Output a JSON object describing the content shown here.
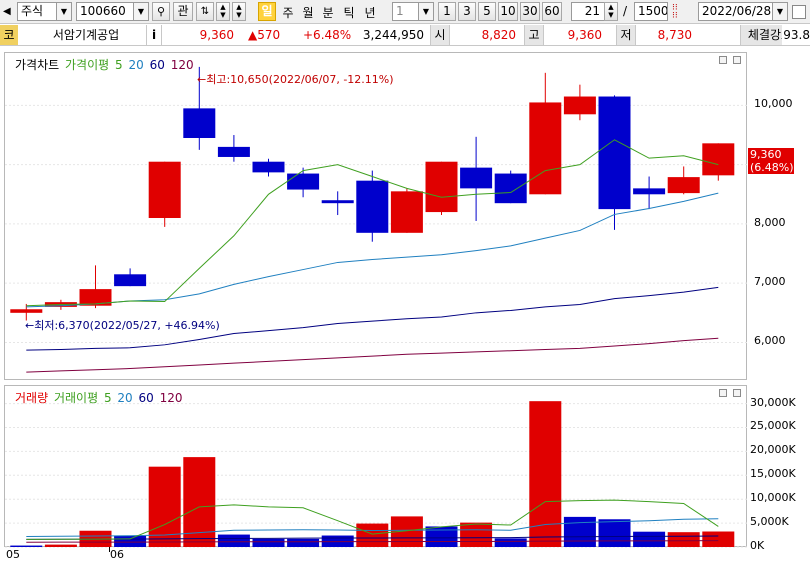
{
  "toolbar": {
    "market_select": "주식",
    "code_input": "100660",
    "gwan_label": "관",
    "il_label": "일",
    "ju_label": "주",
    "wol_label": "월",
    "bun_label": "분",
    "tik_label": "틱",
    "nyeon_label": "년",
    "interval_value": "1",
    "interval_buttons": [
      "1",
      "3",
      "5",
      "10",
      "30",
      "60"
    ],
    "count_value": "21",
    "slash": "/",
    "total_value": "1500",
    "date_value": "2022/06/28"
  },
  "info": {
    "kospi_badge": "코",
    "stock_name": "서암기계공업",
    "info_button": "i",
    "price": "9,360",
    "change": "▲570",
    "change_pct": "+6.48%",
    "volume": "3,244,950",
    "open_label": "시",
    "open_value": "8,820",
    "high_label": "고",
    "high_value": "9,360",
    "low_label": "저",
    "low_value": "8,730",
    "strength_label": "체결강도",
    "strength_value": "93.8"
  },
  "price_panel": {
    "legend_main": "가격차트",
    "legend_ma_label": "가격이평",
    "legend_ma5": "5",
    "legend_ma20": "20",
    "legend_ma60": "60",
    "legend_ma120": "120",
    "max_annotation": "←최고:10,650(2022/06/07, -12.11%)",
    "min_annotation": "←최저:6,370(2022/05/27, +46.94%)",
    "current_price_label": "9,360",
    "current_pct_label": "(6.48%)"
  },
  "volume_panel": {
    "legend_main": "거래량",
    "legend_ma_label": "거래이평",
    "legend_ma5": "5",
    "legend_ma20": "20",
    "legend_ma60": "60",
    "legend_ma120": "120"
  },
  "x_labels": [
    "05",
    "06"
  ],
  "colors": {
    "up": "#e00000",
    "down": "#0000cc",
    "ma5": "#3fa020",
    "ma20": "#2080c0",
    "ma60": "#000080",
    "ma120": "#800040"
  },
  "chart_data": [
    {
      "type": "candlestick",
      "title": "가격차트",
      "ylim": [
        5400,
        10800
      ],
      "y_ticks": [
        "10,000",
        "9,000",
        "8,000",
        "7,000",
        "6,000"
      ],
      "y_tick_values": [
        10000,
        9000,
        8000,
        7000,
        6000
      ],
      "candles": [
        {
          "o": 6500,
          "h": 6650,
          "l": 6370,
          "c": 6560
        },
        {
          "o": 6600,
          "h": 6720,
          "l": 6550,
          "c": 6680
        },
        {
          "o": 6620,
          "h": 7300,
          "l": 6580,
          "c": 6900
        },
        {
          "o": 7150,
          "h": 7250,
          "l": 6950,
          "c": 6950
        },
        {
          "o": 8100,
          "h": 9050,
          "l": 7950,
          "c": 9050
        },
        {
          "o": 9950,
          "h": 10650,
          "l": 9250,
          "c": 9450
        },
        {
          "o": 9300,
          "h": 9500,
          "l": 9050,
          "c": 9130
        },
        {
          "o": 9050,
          "h": 9100,
          "l": 8800,
          "c": 8870
        },
        {
          "o": 8850,
          "h": 8950,
          "l": 8450,
          "c": 8580
        },
        {
          "o": 8400,
          "h": 8550,
          "l": 8150,
          "c": 8350
        },
        {
          "o": 8730,
          "h": 8900,
          "l": 7700,
          "c": 7850
        },
        {
          "o": 7850,
          "h": 8600,
          "l": 7850,
          "c": 8550
        },
        {
          "o": 8200,
          "h": 9050,
          "l": 8150,
          "c": 9050
        },
        {
          "o": 8950,
          "h": 9470,
          "l": 8050,
          "c": 8600
        },
        {
          "o": 8850,
          "h": 8900,
          "l": 8350,
          "c": 8350
        },
        {
          "o": 8500,
          "h": 10550,
          "l": 8500,
          "c": 10050
        },
        {
          "o": 9850,
          "h": 10350,
          "l": 9750,
          "c": 10150
        },
        {
          "o": 10150,
          "h": 10170,
          "l": 7900,
          "c": 8250
        },
        {
          "o": 8600,
          "h": 8800,
          "l": 8250,
          "c": 8500
        },
        {
          "o": 8520,
          "h": 8970,
          "l": 8500,
          "c": 8790
        },
        {
          "o": 8820,
          "h": 9360,
          "l": 8730,
          "c": 9360
        }
      ],
      "ma5": [
        6620,
        6640,
        6650,
        6700,
        6690,
        7250,
        7800,
        8500,
        8900,
        9000,
        8800,
        8600,
        8450,
        8500,
        8530,
        8900,
        9000,
        9420,
        9110,
        9150,
        9000
      ],
      "ma20": [
        6600,
        6620,
        6650,
        6700,
        6720,
        6820,
        6980,
        7110,
        7230,
        7350,
        7400,
        7440,
        7480,
        7550,
        7630,
        7760,
        7890,
        8160,
        8260,
        8380,
        8520
      ],
      "ma60": [
        5870,
        5880,
        5900,
        5910,
        5960,
        6050,
        6150,
        6200,
        6250,
        6320,
        6360,
        6400,
        6430,
        6500,
        6540,
        6600,
        6640,
        6740,
        6790,
        6850,
        6930
      ],
      "ma120": [
        5500,
        5520,
        5540,
        5560,
        5590,
        5620,
        5650,
        5680,
        5710,
        5740,
        5770,
        5800,
        5820,
        5840,
        5860,
        5880,
        5900,
        5940,
        5980,
        6030,
        6070
      ]
    },
    {
      "type": "bar",
      "title": "거래량",
      "ylim": [
        0,
        32000
      ],
      "y_ticks": [
        "30,000K",
        "25,000K",
        "20,000K",
        "15,000K",
        "10,000K",
        "5,000K",
        "0K"
      ],
      "y_tick_values": [
        30000,
        25000,
        20000,
        15000,
        10000,
        5000,
        0
      ],
      "values": [
        300,
        500,
        3400,
        2300,
        16800,
        18800,
        2600,
        1700,
        1700,
        2400,
        4900,
        6400,
        4300,
        5100,
        1800,
        30500,
        6300,
        5800,
        3200,
        3100,
        3240
      ],
      "directions": [
        "down",
        "up",
        "up",
        "down",
        "up",
        "up",
        "down",
        "down",
        "down",
        "down",
        "up",
        "up",
        "down",
        "up",
        "down",
        "up",
        "down",
        "down",
        "down",
        "up",
        "up"
      ],
      "ma5": [
        1600,
        1620,
        1650,
        1700,
        4700,
        8400,
        8800,
        8400,
        8200,
        5500,
        2700,
        3400,
        4200,
        4800,
        4600,
        9500,
        9700,
        9800,
        9500,
        9100,
        4300
      ],
      "ma20": [
        2200,
        2250,
        2300,
        2350,
        2500,
        3000,
        3500,
        3550,
        3600,
        3550,
        3450,
        3500,
        3550,
        3600,
        3500,
        4700,
        5100,
        5300,
        5500,
        5800,
        5900
      ],
      "ma60": [
        1600,
        1620,
        1640,
        1660,
        1700,
        1750,
        1780,
        1800,
        1850,
        1870,
        1880,
        1900,
        1920,
        1940,
        1960,
        2100,
        2150,
        2200,
        2230,
        2260,
        2300
      ],
      "ma120": [
        1000,
        1010,
        1020,
        1030,
        1050,
        1070,
        1090,
        1100,
        1110,
        1120,
        1130,
        1140,
        1150,
        1160,
        1170,
        1220,
        1250,
        1270,
        1290,
        1310,
        1330
      ]
    }
  ]
}
